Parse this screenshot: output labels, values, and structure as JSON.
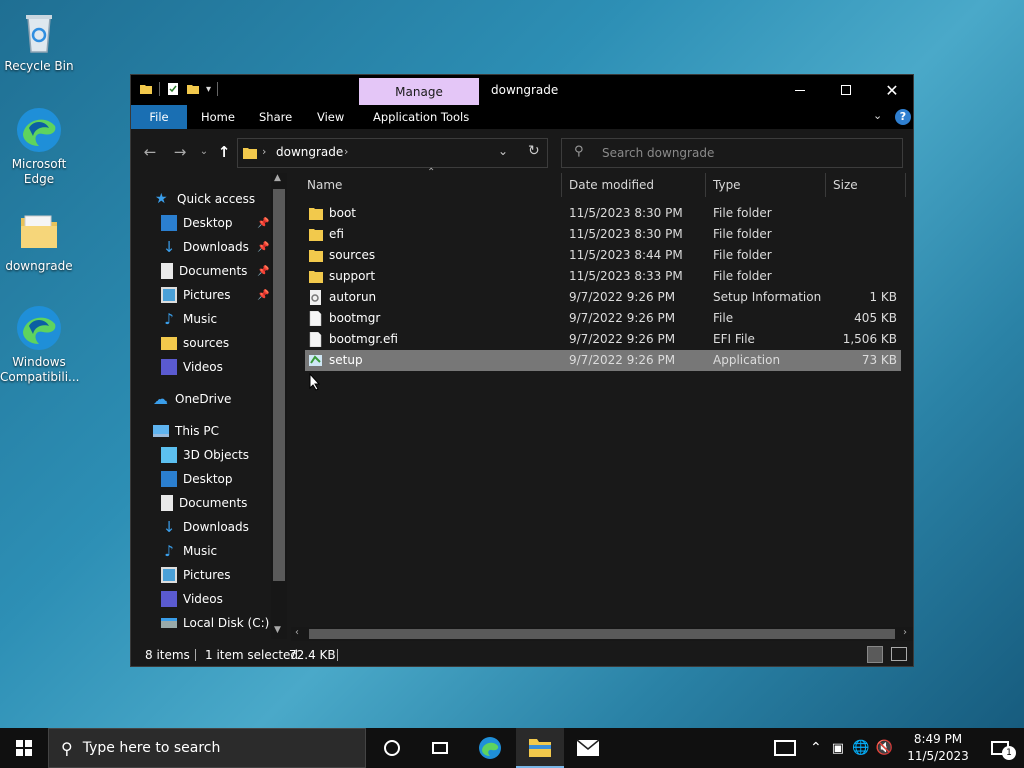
{
  "desktop": {
    "icons": [
      {
        "label": "Recycle Bin",
        "icon": "recycle-bin-icon"
      },
      {
        "label": "Microsoft Edge",
        "icon": "edge-icon"
      },
      {
        "label": "downgrade",
        "icon": "folder-icon"
      },
      {
        "label": "Windows Compatibili...",
        "icon": "edge-icon"
      }
    ]
  },
  "window": {
    "title": "downgrade",
    "contextual_tab": "Manage",
    "ribbon_tabs": [
      "File",
      "Home",
      "Share",
      "View",
      "Application Tools"
    ],
    "address": {
      "crumb": "downgrade"
    },
    "search": {
      "placeholder": "Search downgrade"
    },
    "nav": {
      "quick_access": "Quick access",
      "quick_items": [
        "Desktop",
        "Downloads",
        "Documents",
        "Pictures",
        "Music",
        "sources",
        "Videos"
      ],
      "onedrive": "OneDrive",
      "this_pc": "This PC",
      "pc_items": [
        "3D Objects",
        "Desktop",
        "Documents",
        "Downloads",
        "Music",
        "Pictures",
        "Videos",
        "Local Disk (C:)"
      ]
    },
    "columns": {
      "name": "Name",
      "date": "Date modified",
      "type": "Type",
      "size": "Size"
    },
    "files": [
      {
        "name": "boot",
        "date": "11/5/2023 8:30 PM",
        "type": "File folder",
        "size": "",
        "icon": "folder"
      },
      {
        "name": "efi",
        "date": "11/5/2023 8:30 PM",
        "type": "File folder",
        "size": "",
        "icon": "folder"
      },
      {
        "name": "sources",
        "date": "11/5/2023 8:44 PM",
        "type": "File folder",
        "size": "",
        "icon": "folder"
      },
      {
        "name": "support",
        "date": "11/5/2023 8:33 PM",
        "type": "File folder",
        "size": "",
        "icon": "folder"
      },
      {
        "name": "autorun",
        "date": "9/7/2022 9:26 PM",
        "type": "Setup Information",
        "size": "1 KB",
        "icon": "settings-file"
      },
      {
        "name": "bootmgr",
        "date": "9/7/2022 9:26 PM",
        "type": "File",
        "size": "405 KB",
        "icon": "file"
      },
      {
        "name": "bootmgr.efi",
        "date": "9/7/2022 9:26 PM",
        "type": "EFI File",
        "size": "1,506 KB",
        "icon": "file"
      },
      {
        "name": "setup",
        "date": "9/7/2022 9:26 PM",
        "type": "Application",
        "size": "73 KB",
        "icon": "setup-app",
        "selected": true
      }
    ],
    "status": {
      "count": "8 items",
      "selected": "1 item selected",
      "size": "72.4 KB"
    }
  },
  "taskbar": {
    "search_placeholder": "Type here to search",
    "time": "8:49 PM",
    "date": "11/5/2023",
    "notification_count": "1"
  },
  "colors": {
    "accent": "#1a6fb3",
    "manage_tab": "#e4c6f7",
    "selection": "#777777"
  }
}
